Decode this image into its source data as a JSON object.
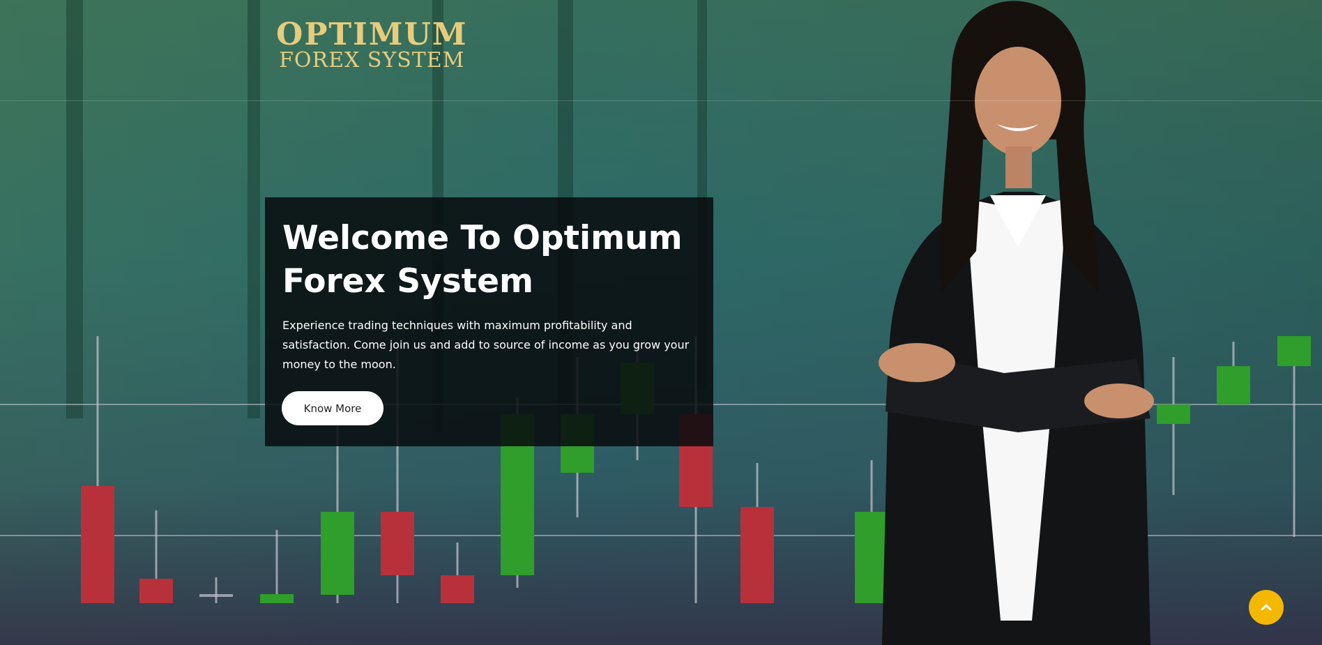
{
  "logo": {
    "line1": "OPTIMUM",
    "line2": "FOREX SYSTEM"
  },
  "hero": {
    "title": "Welcome To Optimum Forex System",
    "description": "Experience trading techniques with maximum profitability and satisfaction. Come join us and add to source of income as you grow your money to the moon.",
    "button_label": "Know More"
  },
  "scroll_top": {
    "icon": "chevron-up-icon"
  },
  "colors": {
    "logo_gold": "#e7cc7c",
    "bullish_green": "#2f9e2a",
    "bearish_red": "#b8313a",
    "scroll_button": "#f5b800"
  }
}
